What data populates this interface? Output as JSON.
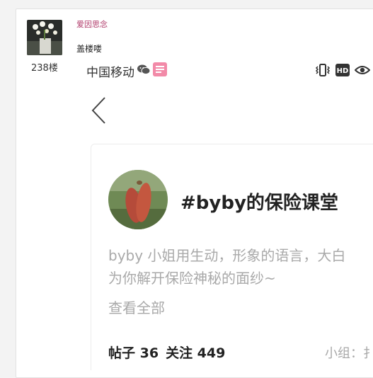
{
  "post": {
    "username": "爱因思念",
    "text": "盖楼喽",
    "floor": "238楼"
  },
  "screenshot": {
    "carrier": "中国移动",
    "status_hd": "HD",
    "group_name": "#byby的保险课堂",
    "description_line1": "byby 小姐用生动，形象的语言，大白",
    "description_line2": "为你解开保险神秘的面纱~",
    "see_all": "查看全部",
    "posts_stat": "帖子 36",
    "follow_stat": "关注 449",
    "group_label": "小组：扌"
  },
  "colors": {
    "username": "#b03a6a",
    "muted_text": "#a9a9a9",
    "background": "#f3f3f3"
  }
}
